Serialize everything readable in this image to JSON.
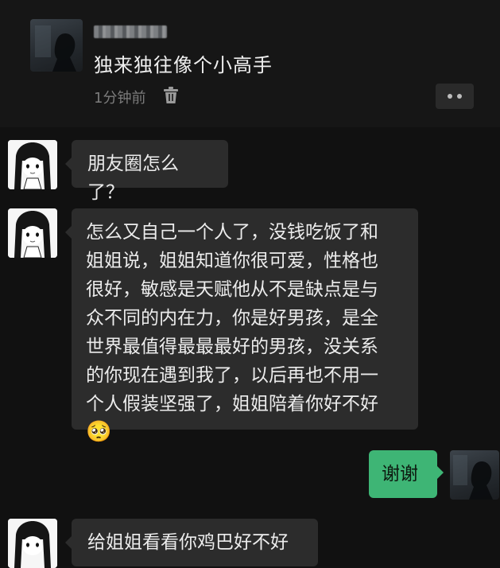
{
  "moment": {
    "caption": "独来独往像个小高手",
    "time": "1分钟前",
    "delete_icon": "trash-icon",
    "more_icon": "more-dots-icon"
  },
  "messages": [
    {
      "side": "left",
      "text": "朋友圈怎么了？"
    },
    {
      "side": "left",
      "text": "怎么又自己一个人了，没钱吃饭了和\n姐姐说，姐姐知道你很可爱，性格也\n很好，敏感是天赋他从不是缺点是与\n众不同的内在力，你是好男孩，是全\n世界最值得最最最好的男孩，没关系\n的你现在遇到我了，以后再也不用一\n个人假装坚强了，姐姐陪着你好不好",
      "emoji": "🥺"
    },
    {
      "side": "right",
      "text": "谢谢"
    },
    {
      "side": "left",
      "text": "给姐姐看看你鸡巴好不好"
    }
  ],
  "colors": {
    "background": "#111111",
    "bubble_left": "#2c2c2c",
    "bubble_right": "#3eb575"
  }
}
